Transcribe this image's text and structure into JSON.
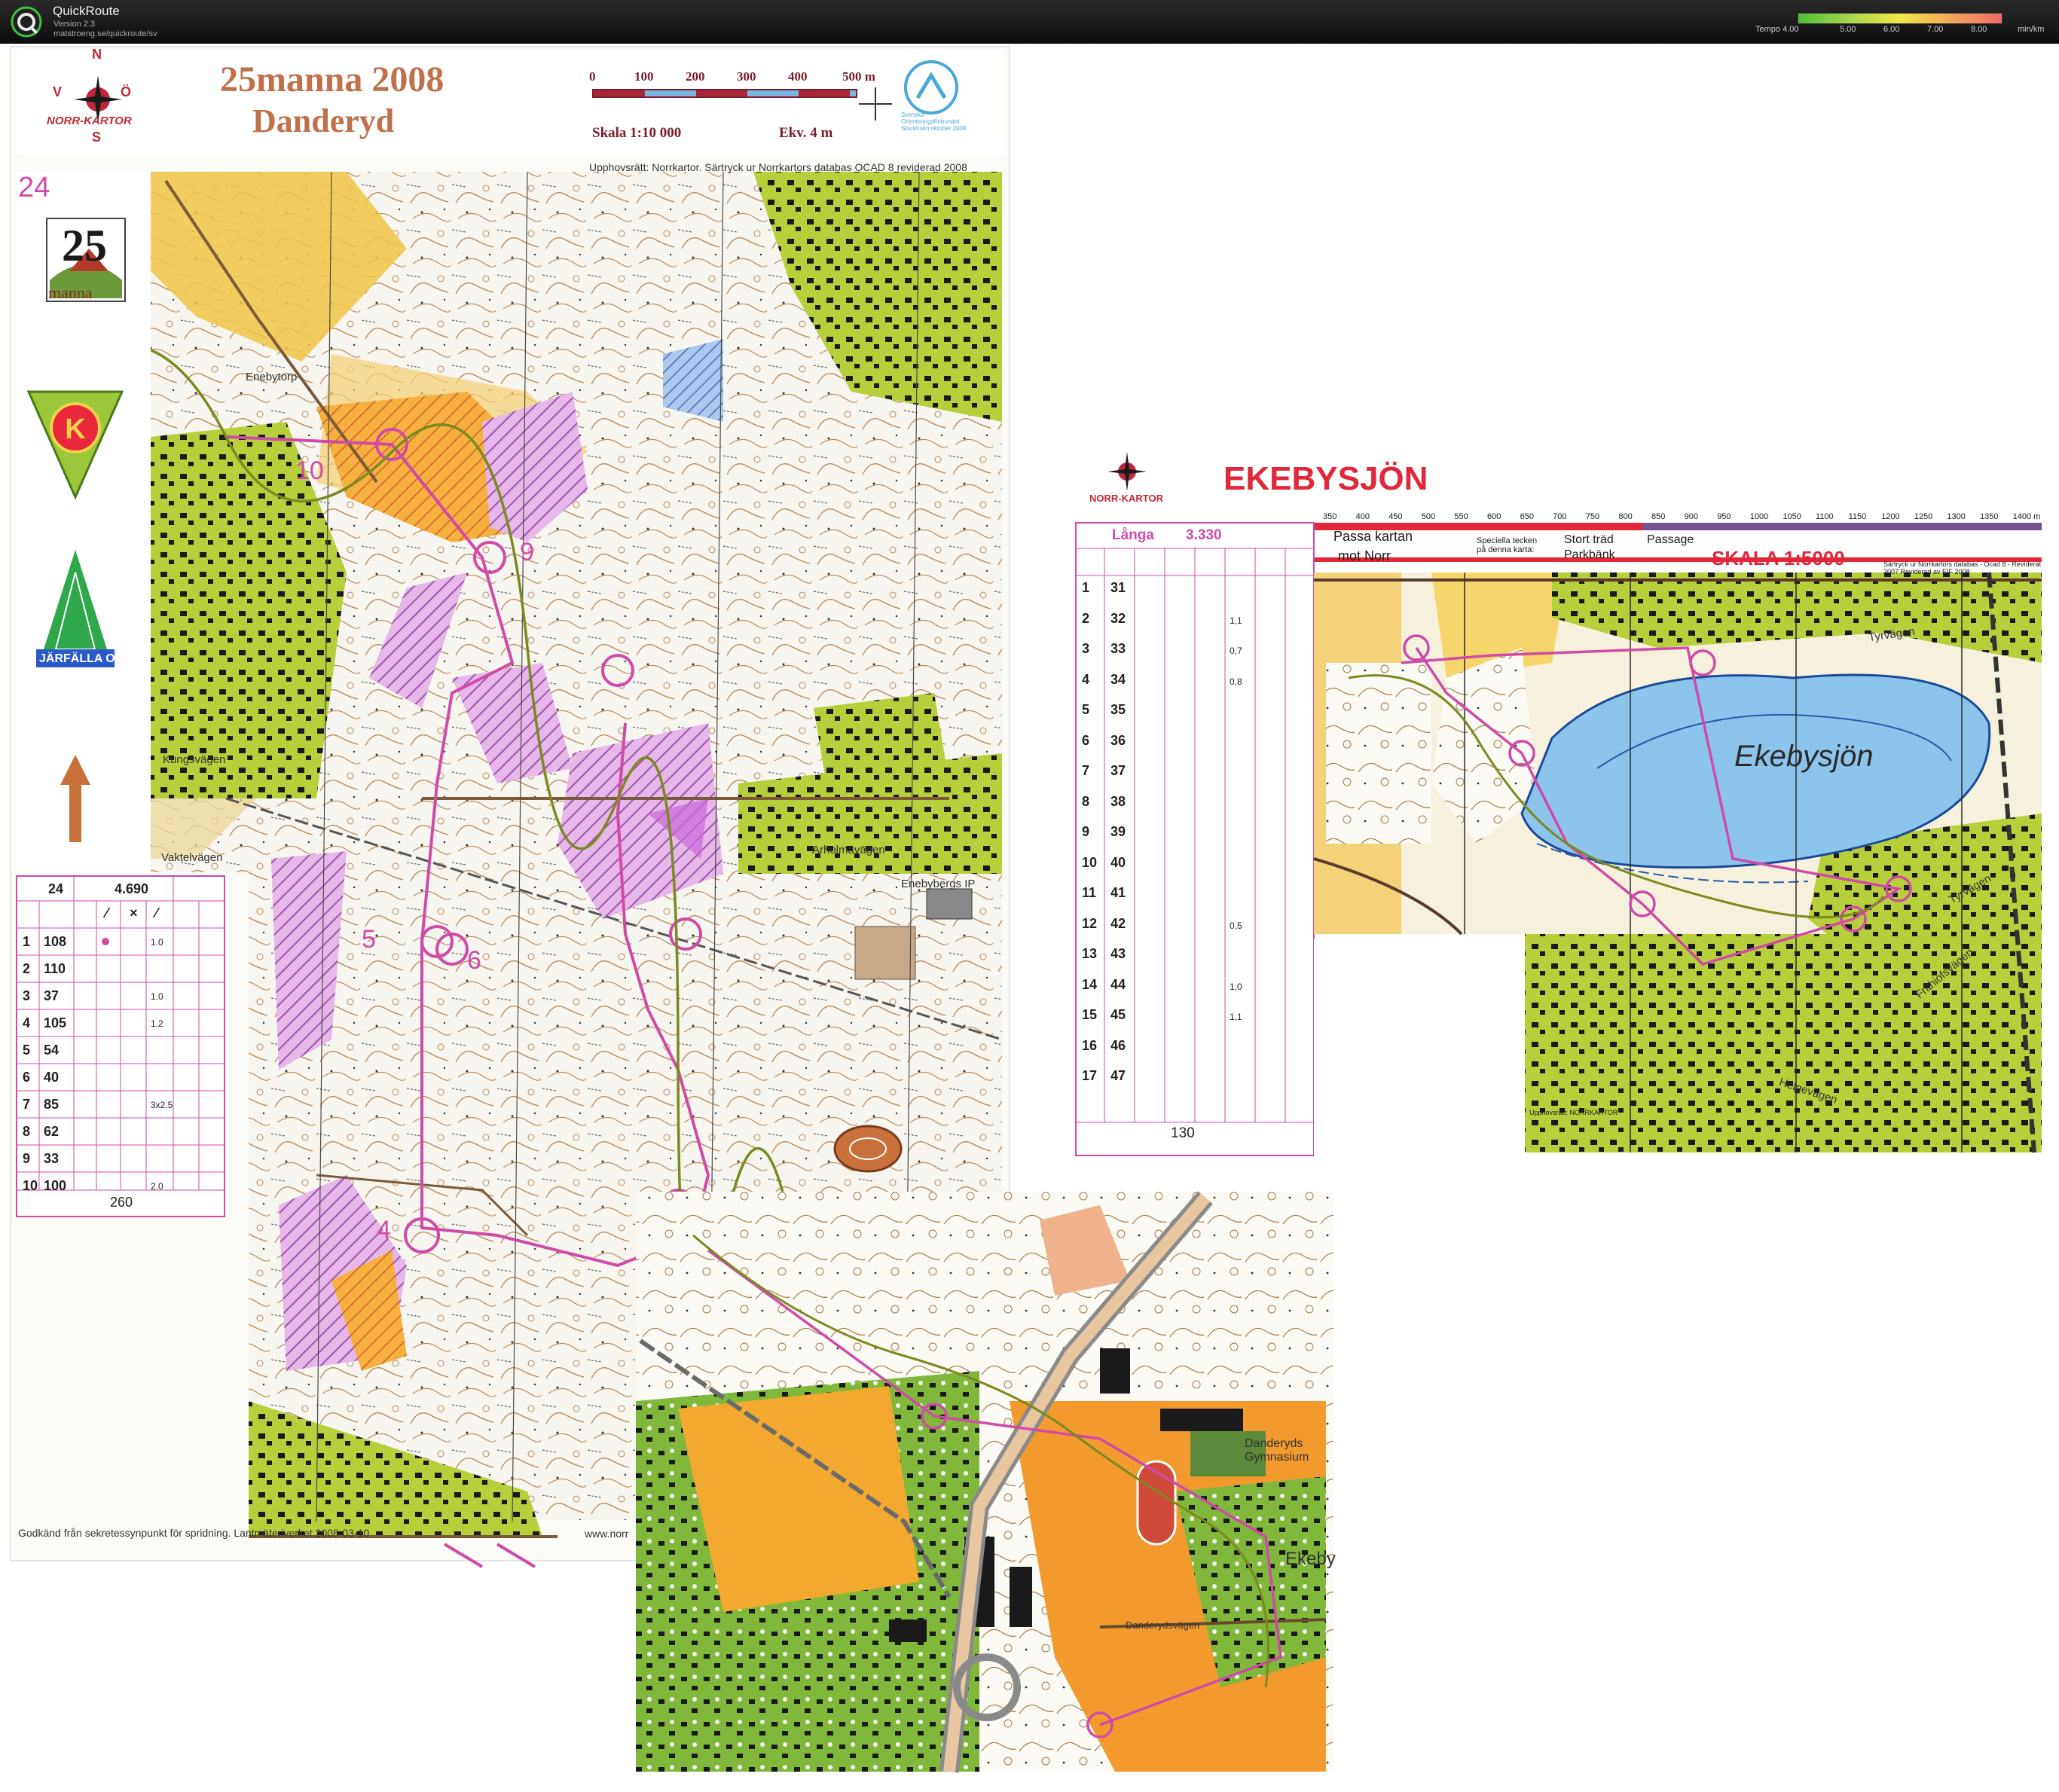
{
  "app": {
    "name": "QuickRoute",
    "version": "Version 2.3",
    "url": "matstroeng.se/quickroute/sv",
    "logo_letter": "Q",
    "tempo_label": "Tempo 4.00",
    "tempo_ticks": [
      "5.00",
      "6.00",
      "7.00",
      "8.00"
    ],
    "tempo_unit": "min/km"
  },
  "map1": {
    "title": "25manna 2008",
    "subtitle": "Danderyd",
    "scale_numbers": [
      "0",
      "100",
      "200",
      "300",
      "400",
      "500 m"
    ],
    "scale_text": "Skala 1:10 000",
    "ekv_text": "Ekv. 4 m",
    "copyright": "Upphovsrätt: Norrkartor.  Särtryck ur Norrkartors databas OCAD 8 reviderad 2008",
    "footer": "Godkänd från sekretessynpunkt för spridning. Lantmäteriverket 2008-03-10",
    "footer_right": "www.norr",
    "leg_number": "24",
    "compass_letters": [
      "N",
      "V",
      "Ö",
      "S"
    ],
    "brand": "NORR-KARTOR",
    "club_label": "JÄRFÄLLA OK",
    "emblem_number": "25",
    "emblem_word": "manna",
    "federation_text": "Svenska Orienteringsförbundet Stockholm oktober 2008",
    "places": [
      "Enebytorp",
      "Enebybergs IP",
      "Arholmavägen",
      "Vaktelvägen",
      "Kungsvägen"
    ],
    "course": {
      "header": [
        "24",
        "4.690"
      ],
      "symbols_header": [
        "⁄",
        "×",
        "⁄"
      ],
      "rows": [
        {
          "n": "1",
          "code": "108",
          "d": "1.0"
        },
        {
          "n": "2",
          "code": "110",
          "d": ""
        },
        {
          "n": "3",
          "code": "37",
          "d": "1.0"
        },
        {
          "n": "4",
          "code": "105",
          "d": "1.2"
        },
        {
          "n": "5",
          "code": "54",
          "d": ""
        },
        {
          "n": "6",
          "code": "40",
          "d": ""
        },
        {
          "n": "7",
          "code": "85",
          "d": "3x2.5"
        },
        {
          "n": "8",
          "code": "62",
          "d": ""
        },
        {
          "n": "9",
          "code": "33",
          "d": ""
        },
        {
          "n": "10",
          "code": "100",
          "d": "2.0"
        }
      ],
      "footer": "260"
    },
    "control_labels": [
      "9",
      "10",
      "4",
      "5",
      "6"
    ]
  },
  "map2": {
    "title": "EKEBYSJÖN",
    "lake": "Ekebysjön",
    "brand": "NORR-KARTOR",
    "course_name": "Långa",
    "course_length": "3.330",
    "scale_text": "SKALA 1:5000",
    "note1": "Passa kartan",
    "note2": "mot Norr",
    "legend_special": "Speciella tecken på denna karta:",
    "legend_items": [
      "Stort träd",
      "Parkbänk",
      "Passage"
    ],
    "scale_numbers": [
      "350",
      "400",
      "450",
      "500",
      "550",
      "600",
      "650",
      "700",
      "750",
      "800",
      "850",
      "900",
      "950",
      "1000",
      "1050",
      "1100",
      "1150",
      "1200",
      "1250",
      "1300",
      "1350",
      "1400 m"
    ],
    "rows": [
      {
        "n": "1",
        "code": "31",
        "d": ""
      },
      {
        "n": "2",
        "code": "32",
        "d": "1,1"
      },
      {
        "n": "3",
        "code": "33",
        "d": "0,7"
      },
      {
        "n": "4",
        "code": "34",
        "d": "0,8"
      },
      {
        "n": "5",
        "code": "35",
        "d": ""
      },
      {
        "n": "6",
        "code": "36",
        "d": ""
      },
      {
        "n": "7",
        "code": "37",
        "d": ""
      },
      {
        "n": "8",
        "code": "38",
        "d": ""
      },
      {
        "n": "9",
        "code": "39",
        "d": ""
      },
      {
        "n": "10",
        "code": "40",
        "d": ""
      },
      {
        "n": "11",
        "code": "41",
        "d": ""
      },
      {
        "n": "12",
        "code": "42",
        "d": "0,5"
      },
      {
        "n": "13",
        "code": "43",
        "d": ""
      },
      {
        "n": "14",
        "code": "44",
        "d": "1,0"
      },
      {
        "n": "15",
        "code": "45",
        "d": "1,1"
      },
      {
        "n": "16",
        "code": "46",
        "d": ""
      },
      {
        "n": "17",
        "code": "47",
        "d": ""
      }
    ],
    "footer": "130",
    "streets": [
      "Tyrvägen",
      "Tyrvägen",
      "Frithiofsvägen",
      "Helgevägen"
    ],
    "copyright": "Upphovsrätt: NORRKARTOR",
    "revision": "Särtryck ur Norrkartors databas - Ocad 8 - Reviderat 2007 Reviderad av EIF 2008"
  },
  "map3": {
    "places": [
      "Danderyds Gymnasium",
      "Ekeby",
      "Danderydsvägen"
    ]
  },
  "colors": {
    "forest_green": "#8fc43c",
    "open_yellow": "#f2c94a",
    "orange": "#f29a2e",
    "lake_blue": "#8cc4ec",
    "course_magenta": "#d04aa8",
    "route_olive": "#7a8a1e",
    "map_white": "#f7f5ef"
  }
}
